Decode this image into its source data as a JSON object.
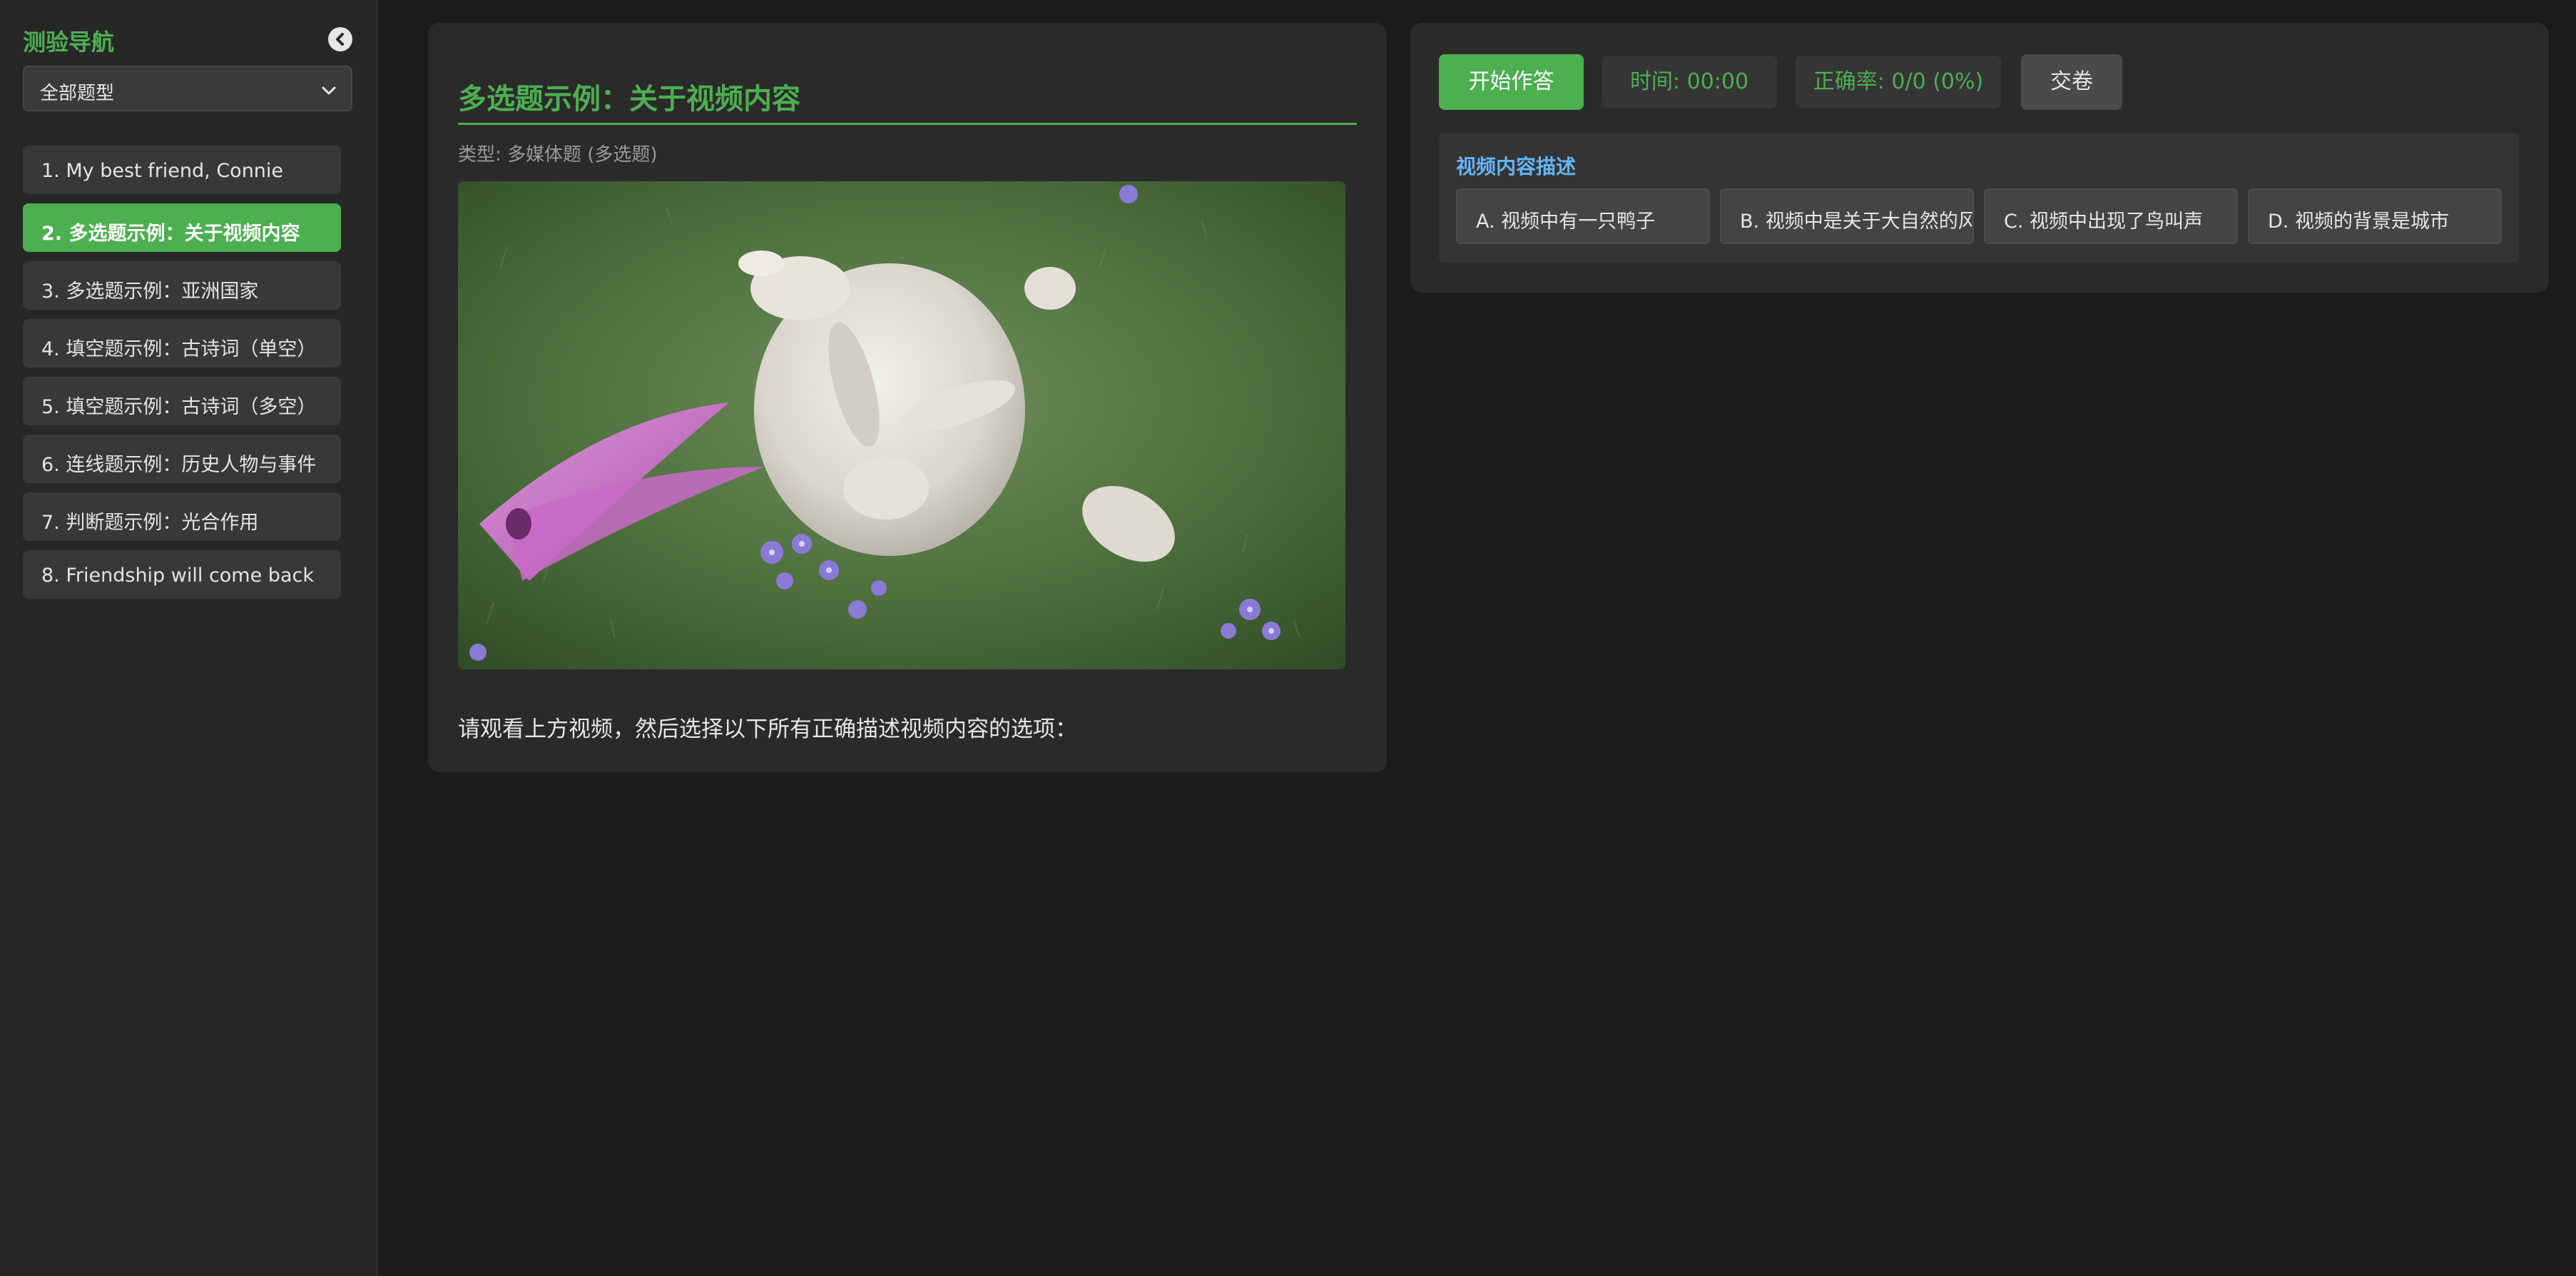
{
  "sidebar": {
    "title": "测验导航",
    "filter": {
      "selected": "全部题型"
    },
    "items": [
      {
        "label": "1. My best friend, Connie",
        "active": false
      },
      {
        "label": "2. 多选题示例：关于视频内容",
        "active": true
      },
      {
        "label": "3. 多选题示例：亚洲国家",
        "active": false
      },
      {
        "label": "4. 填空题示例：古诗词（单空）",
        "active": false
      },
      {
        "label": "5. 填空题示例：古诗词（多空）",
        "active": false
      },
      {
        "label": "6. 连线题示例：历史人物与事件",
        "active": false
      },
      {
        "label": "7. 判断题示例：光合作用",
        "active": false
      },
      {
        "label": "8. Friendship will come back",
        "active": false
      }
    ]
  },
  "question": {
    "title": "多选题示例：关于视频内容",
    "type_line": "类型: 多媒体题 (多选题)",
    "prompt": "请观看上方视频，然后选择以下所有正确描述视频内容的选项："
  },
  "controls": {
    "start_label": "开始作答",
    "timer": "时间: 00:00",
    "accuracy": "正确率: 0/0 (0%)",
    "submit_label": "交卷"
  },
  "options_group": {
    "title": "视频内容描述",
    "options": [
      {
        "label": "A. 视频中有一只鸭子"
      },
      {
        "label": "B. 视频中是关于大自然的风景"
      },
      {
        "label": "C. 视频中出现了鸟叫声"
      },
      {
        "label": "D. 视频的背景是城市"
      }
    ]
  },
  "colors": {
    "accent": "#4caf50",
    "group_title": "#64b5f6",
    "background": "#1b1b1b",
    "panel": "#2a2a2a"
  },
  "icons": {
    "collapse": "chevron-left-icon",
    "dropdown": "chevron-down-icon"
  }
}
